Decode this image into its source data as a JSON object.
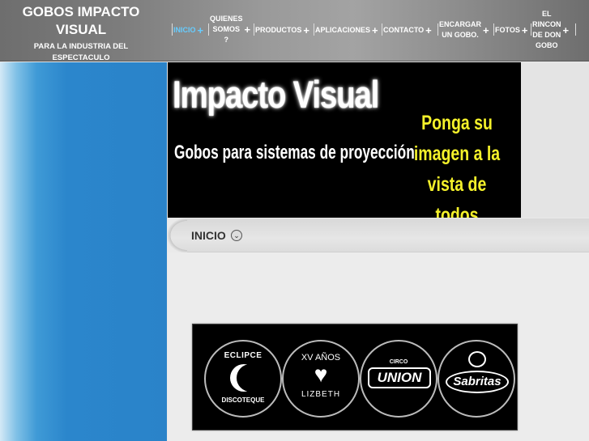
{
  "brand": {
    "title_line1": "GOBOS IMPACTO",
    "title_line2": "VISUAL",
    "subtitle_line1": "PARA LA INDUSTRIA DEL",
    "subtitle_line2": "ESPECTACULO"
  },
  "nav": {
    "items": [
      {
        "label": "INICIO",
        "active": true
      },
      {
        "label_lines": [
          "QUIENES",
          "SOMOS",
          "?"
        ]
      },
      {
        "label": "PRODUCTOS"
      },
      {
        "label": "APLICACIONES"
      },
      {
        "label": "CONTACTO"
      },
      {
        "label_lines": [
          "ENCARGAR",
          "UN GOBO."
        ]
      },
      {
        "label": "FOTOS"
      },
      {
        "label_lines": [
          "EL",
          "RINCON",
          "DE DON",
          "GOBO"
        ]
      }
    ],
    "plus": "+",
    "active_color": "#66ccff"
  },
  "banner": {
    "title": "Impacto Visual",
    "subtitle": "Gobos para sistemas de proyección",
    "slogan_line1": "Ponga su imagen a la",
    "slogan_line2": "vista de todos",
    "slogan_color": "#f4f12a"
  },
  "page": {
    "title": "INICIO",
    "toggle_icon": "⌄"
  },
  "gobos": [
    {
      "top": "ECLIPCE",
      "bottom": "DISCOTEQUE"
    },
    {
      "top": "XV AÑOS",
      "bottom": "LIZBETH"
    },
    {
      "top": "CIRCO",
      "main": "UNION"
    },
    {
      "main": "Sabritas"
    }
  ],
  "colors": {
    "left_column": "#2a83c9",
    "header": "#8a8a8a"
  }
}
